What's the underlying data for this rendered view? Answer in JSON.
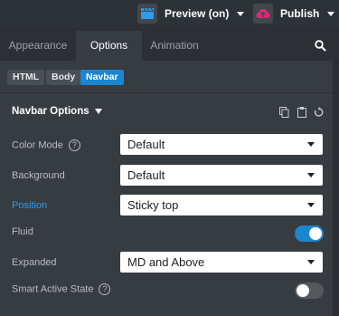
{
  "topbar": {
    "preview_label": "Preview (on)",
    "publish_label": "Publish"
  },
  "tabs": [
    {
      "label": "Appearance"
    },
    {
      "label": "Options"
    },
    {
      "label": "Animation"
    }
  ],
  "breadcrumbs": [
    {
      "label": "HTML"
    },
    {
      "label": "Body"
    },
    {
      "label": "Navbar"
    }
  ],
  "section": {
    "title": "Navbar Options"
  },
  "fields": {
    "color_mode": {
      "label": "Color Mode",
      "value": "Default"
    },
    "background": {
      "label": "Background",
      "value": "Default"
    },
    "position": {
      "label": "Position",
      "value": "Sticky top"
    },
    "fluid": {
      "label": "Fluid",
      "on": true
    },
    "expanded": {
      "label": "Expanded",
      "value": "MD and Above"
    },
    "smart_active_state": {
      "label": "Smart Active State",
      "on": false
    }
  },
  "colors": {
    "accent": "#1a86cf",
    "position_label": "#2b9cf0",
    "publish_icon": "#e0267a",
    "toggle_on": "#1a86cf",
    "toggle_off": "#55595e"
  },
  "icons": {
    "preview": "clapperboard-icon",
    "publish": "cloud-upload-icon",
    "search": "search-icon",
    "copy": "copy-icon",
    "paste": "paste-icon",
    "reset": "reset-icon",
    "help": "help-icon"
  },
  "help_glyph": "?"
}
